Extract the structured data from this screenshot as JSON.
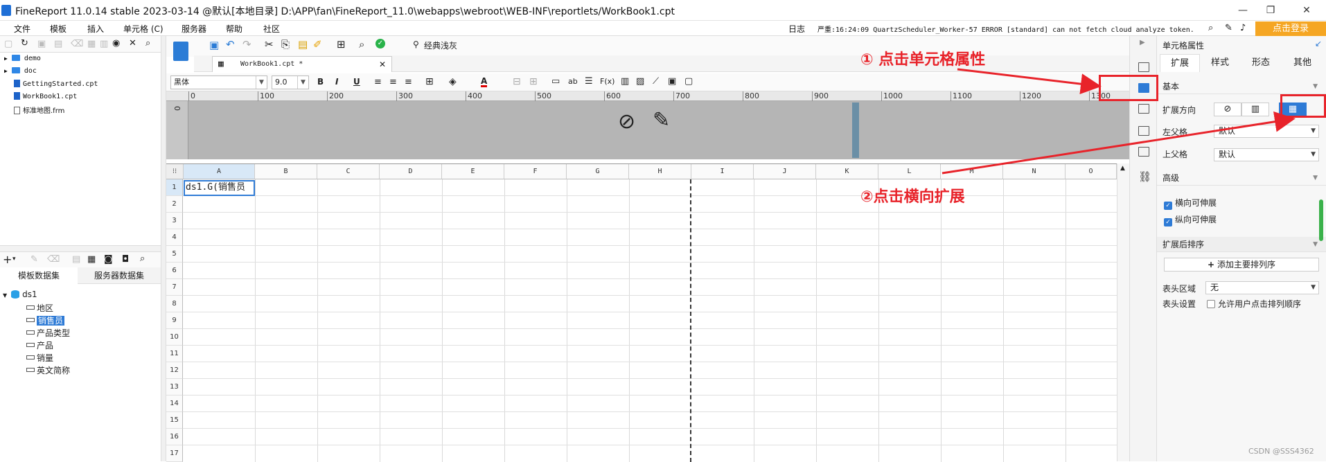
{
  "window": {
    "title": "FineReport 11.0.14 stable 2023-03-14 @默认[本地目录]    D:\\APP\\fan\\FineReport_11.0\\webapps\\webroot\\WEB-INF\\reportlets/WorkBook1.cpt",
    "minimize": "—",
    "restore": "❐",
    "close": "✕"
  },
  "menubar": {
    "items": [
      "文件",
      "模板",
      "插入",
      "单元格 (C)",
      "服务器",
      "帮助",
      "社区"
    ],
    "log_label": "日志",
    "log_message": "严重:16:24:09 QuartzScheduler_Worker-57 ERROR [standard] can not fetch cloud analyze token.",
    "login_label": "点击登录"
  },
  "template_tree": {
    "items": [
      {
        "label": "demo",
        "type": "folder"
      },
      {
        "label": "doc",
        "type": "folder"
      },
      {
        "label": "GettingStarted.cpt",
        "type": "cpt"
      },
      {
        "label": "WorkBook1.cpt",
        "type": "cpt"
      },
      {
        "label": "标准地图.frm",
        "type": "frm"
      }
    ]
  },
  "dataset_panel": {
    "tabs": [
      "模板数据集",
      "服务器数据集"
    ],
    "dataset_name": "ds1",
    "fields": [
      "地区",
      "销售员",
      "产品类型",
      "产品",
      "销量",
      "英文简称"
    ],
    "selected_field": "销售员"
  },
  "editor": {
    "tab_label": "WorkBook1.cpt *",
    "toolbar_text": "经典浅灰",
    "font_name": "黑体",
    "font_size": "9.0",
    "bold": "B",
    "italic": "I",
    "underline": "U",
    "font_color_label": "A",
    "ruler_ticks": [
      "0",
      "100",
      "200",
      "300",
      "400",
      "500",
      "600",
      "700",
      "800",
      "900",
      "1000",
      "1100",
      "1200",
      "1300"
    ],
    "vertical_ruler_zero": "0",
    "columns": [
      "A",
      "B",
      "C",
      "D",
      "E",
      "F",
      "G",
      "H",
      "I",
      "J",
      "K",
      "L",
      "M",
      "N",
      "O"
    ],
    "rows": [
      "1",
      "2",
      "3",
      "4",
      "5",
      "6",
      "7",
      "8",
      "9",
      "10",
      "11",
      "12",
      "13",
      "14",
      "15",
      "16",
      "17"
    ],
    "cell_a1": "ds1.G(销售员"
  },
  "cell_properties": {
    "title": "单元格属性",
    "tabs": [
      "扩展",
      "样式",
      "形态",
      "其他"
    ],
    "active_tab": "扩展",
    "section_basic": "基本",
    "expand_direction_label": "扩展方向",
    "left_parent_label": "左父格",
    "left_parent_value": "默认",
    "top_parent_label": "上父格",
    "top_parent_value": "默认",
    "section_advanced": "高级",
    "horizontal_expandable": "横向可伸展",
    "vertical_expandable": "纵向可伸展",
    "section_sort": "扩展后排序",
    "add_sort_label": "添加主要排列序",
    "header_area_label": "表头区域",
    "header_area_value": "无",
    "header_settings_label": "表头设置",
    "allow_user_sort": "允许用户点击排列顺序"
  },
  "annotations": {
    "step1": "① 点击单元格属性",
    "step2": "②点击横向扩展",
    "color": "#e8232a"
  },
  "watermark": "CSDN @SSS4362"
}
